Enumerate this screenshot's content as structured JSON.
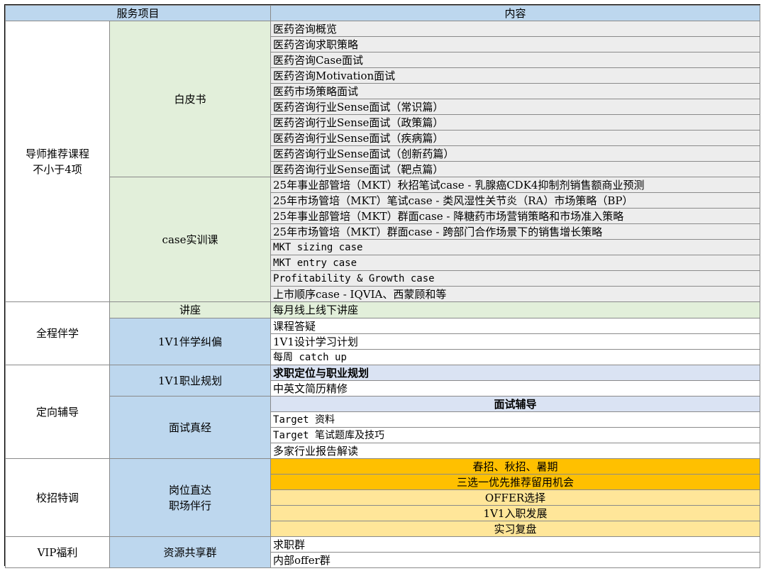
{
  "header": {
    "col1": "服务项目",
    "col3": "内容"
  },
  "sections": {
    "mentor": {
      "title": "导师推荐课程\n不小于4项",
      "whitepaper": {
        "label": "白皮书",
        "items": [
          "医药咨询概览",
          "医药咨询求职策略",
          "医药咨询Case面试",
          "医药咨询Motivation面试",
          "医药市场策略面试",
          "医药咨询行业Sense面试（常识篇）",
          "医药咨询行业Sense面试（政策篇）",
          "医药咨询行业Sense面试（疾病篇）",
          "医药咨询行业Sense面试（创新药篇）",
          "医药咨询行业Sense面试（靶点篇）"
        ]
      },
      "case_training": {
        "label": "case实训课",
        "items": [
          "25年事业部管培（MKT）秋招笔试case - 乳腺癌CDK4抑制剂销售额商业预测",
          "25年市场管培（MKT）笔试case - 类风湿性关节炎（RA）市场策略（BP）",
          "25年事业部管培（MKT）群面case - 降糖药市场营销策略和市场准入策略",
          "25年市场管培（MKT）群面case - 跨部门合作场景下的销售增长策略",
          "MKT sizing case",
          "MKT entry case",
          "Profitability & Growth case",
          "上市顺序case - IQVIA、西蒙顾和等"
        ]
      }
    },
    "companion": {
      "title": "全程伴学",
      "lecture": {
        "label": "讲座",
        "item": "每月线上线下讲座"
      },
      "one_on_one": {
        "label": "1V1伴学纠偏",
        "items": [
          "课程答疑",
          "1V1设计学习计划",
          "每周 catch up"
        ]
      }
    },
    "guidance": {
      "title": "定向辅导",
      "career": {
        "label": "1V1职业规划",
        "items": [
          "求职定位与职业规划",
          "中英文简历精修"
        ]
      },
      "interview": {
        "label": "面试真经",
        "items": [
          "面试辅导",
          "Target 资料",
          "Target 笔试题库及技巧",
          "多家行业报告解读"
        ]
      }
    },
    "campus": {
      "title": "校招特调",
      "direct": {
        "label": "岗位直达\n职场伴行",
        "items": [
          "春招、秋招、暑期",
          "三选一优先推荐留用机会",
          "OFFER选择",
          "1V1入职发展",
          "实习复盘"
        ]
      }
    },
    "vip": {
      "title": "VIP福利",
      "group": {
        "label": "资源共享群",
        "items": [
          "求职群",
          "内部offer群"
        ]
      }
    }
  },
  "colors": {
    "header": "#bdd7ee",
    "green": "#e2efda",
    "gray": "#ededed",
    "blue_light": "#dae3f3",
    "orange": "#ffc000",
    "cream": "#ffe699"
  }
}
